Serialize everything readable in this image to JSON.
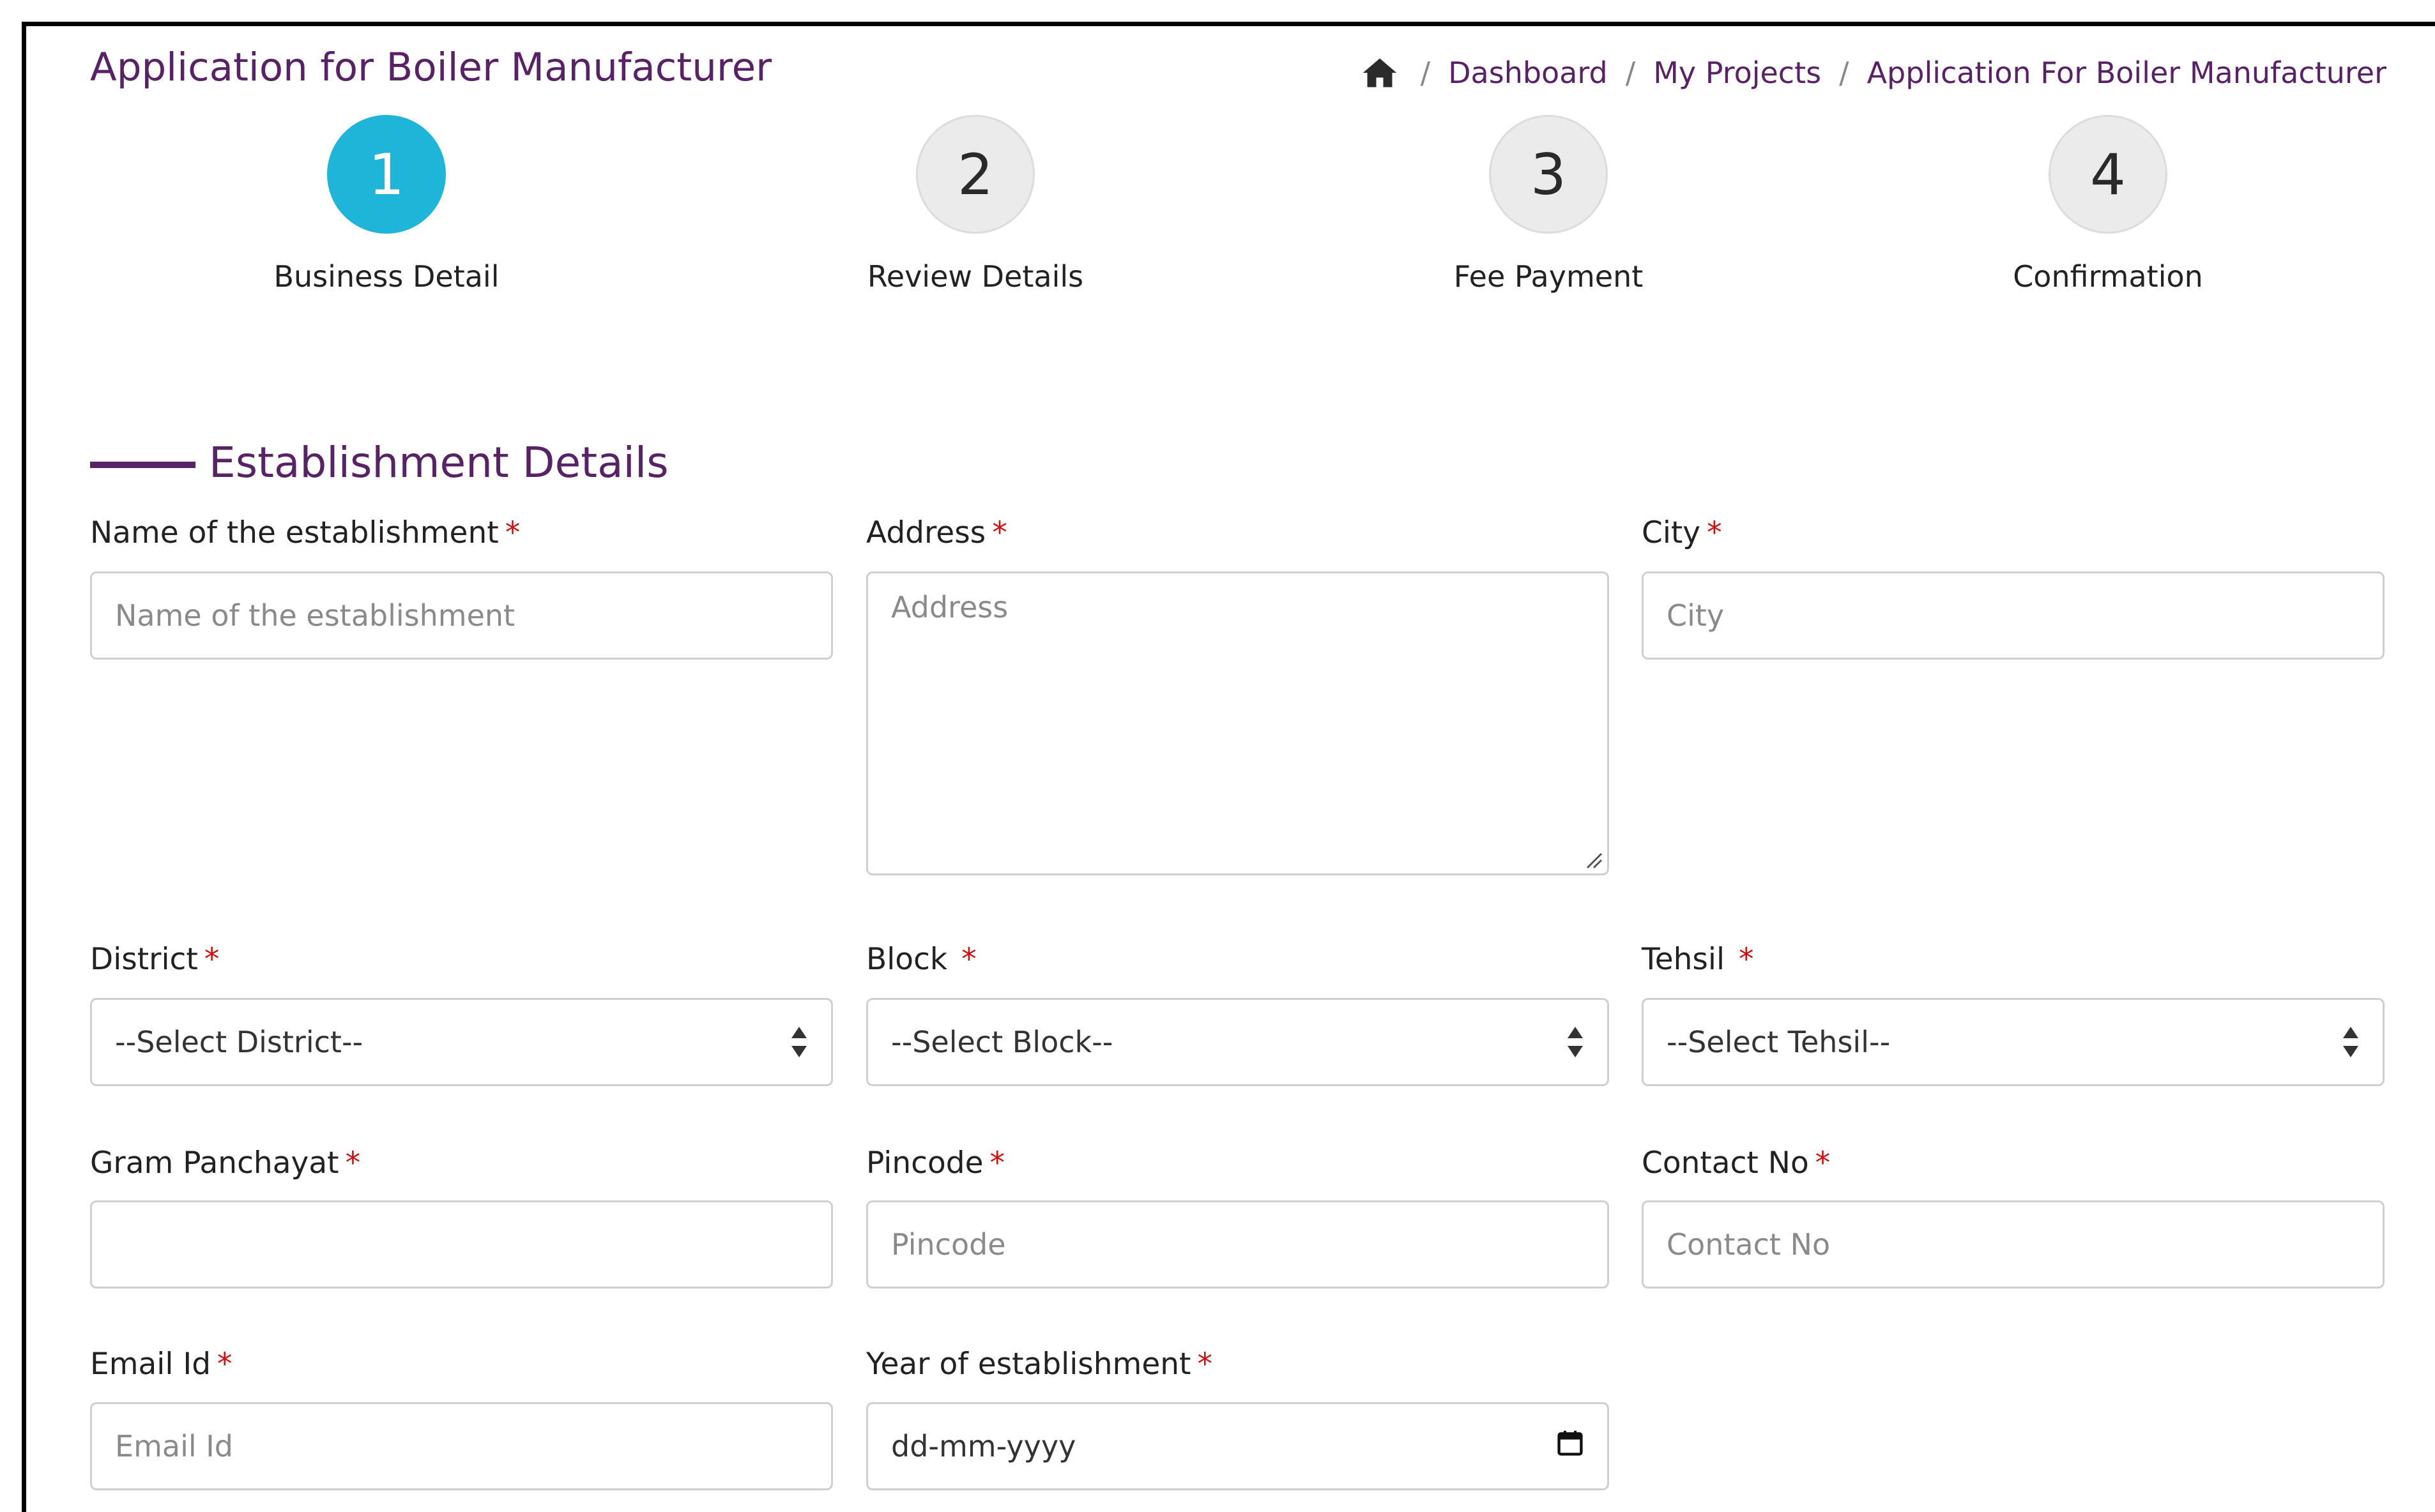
{
  "page": {
    "title": "Application for Boiler Manufacturer"
  },
  "breadcrumb": {
    "home_icon": "home-icon",
    "separator": "/",
    "items": [
      "Dashboard",
      "My Projects",
      "Application For Boiler Manufacturer"
    ]
  },
  "steps": [
    {
      "number": "1",
      "label": "Business Detail",
      "active": true
    },
    {
      "number": "2",
      "label": "Review Details",
      "active": false
    },
    {
      "number": "3",
      "label": "Fee Payment",
      "active": false
    },
    {
      "number": "4",
      "label": "Confirmation",
      "active": false
    }
  ],
  "section": {
    "title": "Establishment Details"
  },
  "fields": {
    "establishment_name": {
      "label": "Name of the establishment",
      "placeholder": "Name of the establishment",
      "required": "*"
    },
    "address": {
      "label": "Address",
      "placeholder": "Address",
      "required": "*"
    },
    "city": {
      "label": "City",
      "placeholder": "City",
      "required": "*"
    },
    "district": {
      "label": "District",
      "selected": "--Select District--",
      "required": "*"
    },
    "block": {
      "label": "Block",
      "selected": "--Select Block--",
      "required": "*"
    },
    "tehsil": {
      "label": "Tehsil",
      "selected": "--Select Tehsil--",
      "required": "*"
    },
    "gram_panchayat": {
      "label": "Gram Panchayat",
      "placeholder": "",
      "required": "*"
    },
    "pincode": {
      "label": "Pincode",
      "placeholder": "Pincode",
      "required": "*"
    },
    "contact_no": {
      "label": "Contact No",
      "placeholder": "Contact No",
      "required": "*"
    },
    "email": {
      "label": "Email Id",
      "placeholder": "Email Id",
      "required": "*"
    },
    "year_established": {
      "label": "Year of establishment",
      "value": "dd-mm-yyyy",
      "required": "*"
    }
  },
  "colors": {
    "brand_purple": "#5a2266",
    "active_step": "#1fb5d8",
    "required_mark": "#d01010"
  },
  "icons": {
    "select_arrows": "sort-arrows-icon",
    "calendar": "calendar-icon"
  }
}
